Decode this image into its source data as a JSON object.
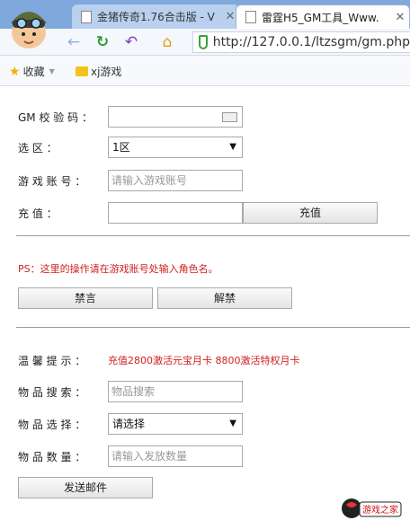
{
  "browser": {
    "tabs": [
      {
        "title": "金猪传奇1.76合击版 - V",
        "active": false
      },
      {
        "title": "雷霆H5_GM工具_Www.",
        "active": true
      }
    ],
    "address": "http://127.0.0.1/ltzsgm/gm.php",
    "bookmarks": {
      "favorites": "收藏",
      "item1": "xj游戏"
    }
  },
  "form": {
    "gm_code_label": "GM 校 验 码 ：",
    "zone_label": "选 区 ：",
    "zone_value": "1区",
    "account_label": "游 戏 账 号 ：",
    "account_placeholder": "请输入游戏账号",
    "recharge_label": "充 值 ：",
    "recharge_button": "充值",
    "ps_note": "PS：这里的操作请在游戏账号处输入角色名。",
    "ban_button": "禁言",
    "unban_button": "解禁",
    "tip_label": "温 馨 提 示 ：",
    "tip_text": "充值2800激活元宝月卡 8800激活特权月卡",
    "item_search_label": "物 品 搜 索 ：",
    "item_search_placeholder": "物品搜索",
    "item_select_label": "物 品 选 择 ：",
    "item_select_value": "请选择",
    "item_qty_label": "物 品 数 量 ：",
    "item_qty_placeholder": "请输入发放数量",
    "send_mail_button": "发送邮件"
  },
  "watermark": {
    "text": "游戏之家"
  },
  "colors": {
    "tip_red": "#d21e1e",
    "tab_blue": "#7fa9dd"
  }
}
